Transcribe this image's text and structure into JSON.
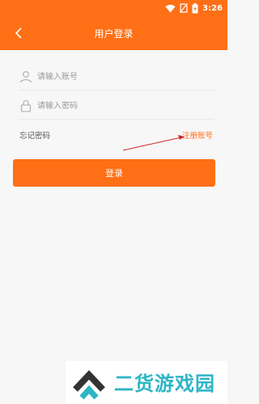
{
  "status_bar": {
    "time": "3:26",
    "icons": [
      "wifi-icon",
      "sim-off-icon",
      "battery-icon"
    ]
  },
  "header": {
    "title": "用户登录",
    "back_icon": "chevron-left-icon",
    "bg_color": "#ff6f16"
  },
  "form": {
    "account": {
      "placeholder": "请输入账号",
      "value": "",
      "icon": "user-icon"
    },
    "password": {
      "placeholder": "请输入密码",
      "value": "",
      "icon": "lock-icon"
    },
    "forgot_label": "忘记密码",
    "register_label": "注册账号",
    "login_label": "登录"
  },
  "watermark": {
    "text": "二货游戏园"
  },
  "colors": {
    "accent": "#ff6f16",
    "watermark_teal": "#2db5c5",
    "watermark_dark": "#333333"
  }
}
